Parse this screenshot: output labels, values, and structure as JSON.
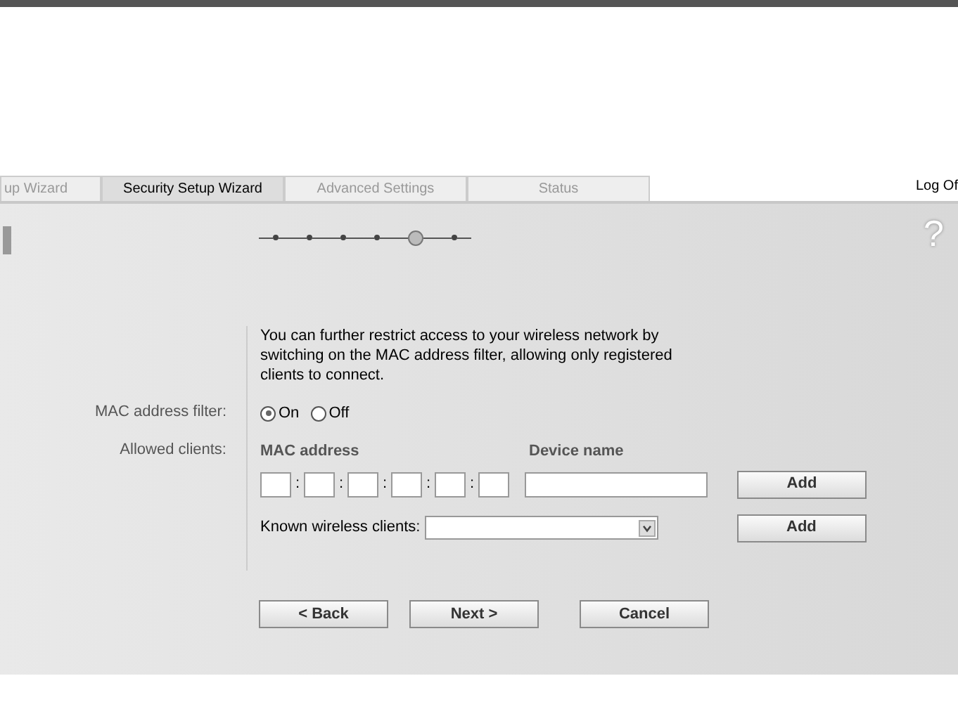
{
  "tabs": [
    {
      "label": "up Wizard",
      "selected": false
    },
    {
      "label": "Security Setup Wizard",
      "selected": true
    },
    {
      "label": "Advanced Settings",
      "selected": false
    },
    {
      "label": "Status",
      "selected": false
    }
  ],
  "logoff": "Log Of",
  "progress": [
    {
      "selected": false
    },
    {
      "selected": false
    },
    {
      "selected": false
    },
    {
      "selected": false
    },
    {
      "selected": true
    },
    {
      "selected": false
    }
  ],
  "help": "?",
  "description": "You can further restrict access to your wireless network by switching on the MAC address filter, allowing only registered clients to connect.",
  "mac_filter": {
    "label": "MAC address filter:",
    "options": [
      {
        "label": "On",
        "selected": true
      },
      {
        "label": "Off",
        "selected": false
      }
    ]
  },
  "allowed_clients": {
    "label": "Allowed clients:",
    "mac_heading": "MAC address",
    "device_heading": "Device name",
    "separator": ":",
    "add": "Add",
    "known_label": "Known wireless clients:",
    "known_add": "Add"
  },
  "buttons": [
    "< Back",
    "Next >",
    "Cancel"
  ]
}
